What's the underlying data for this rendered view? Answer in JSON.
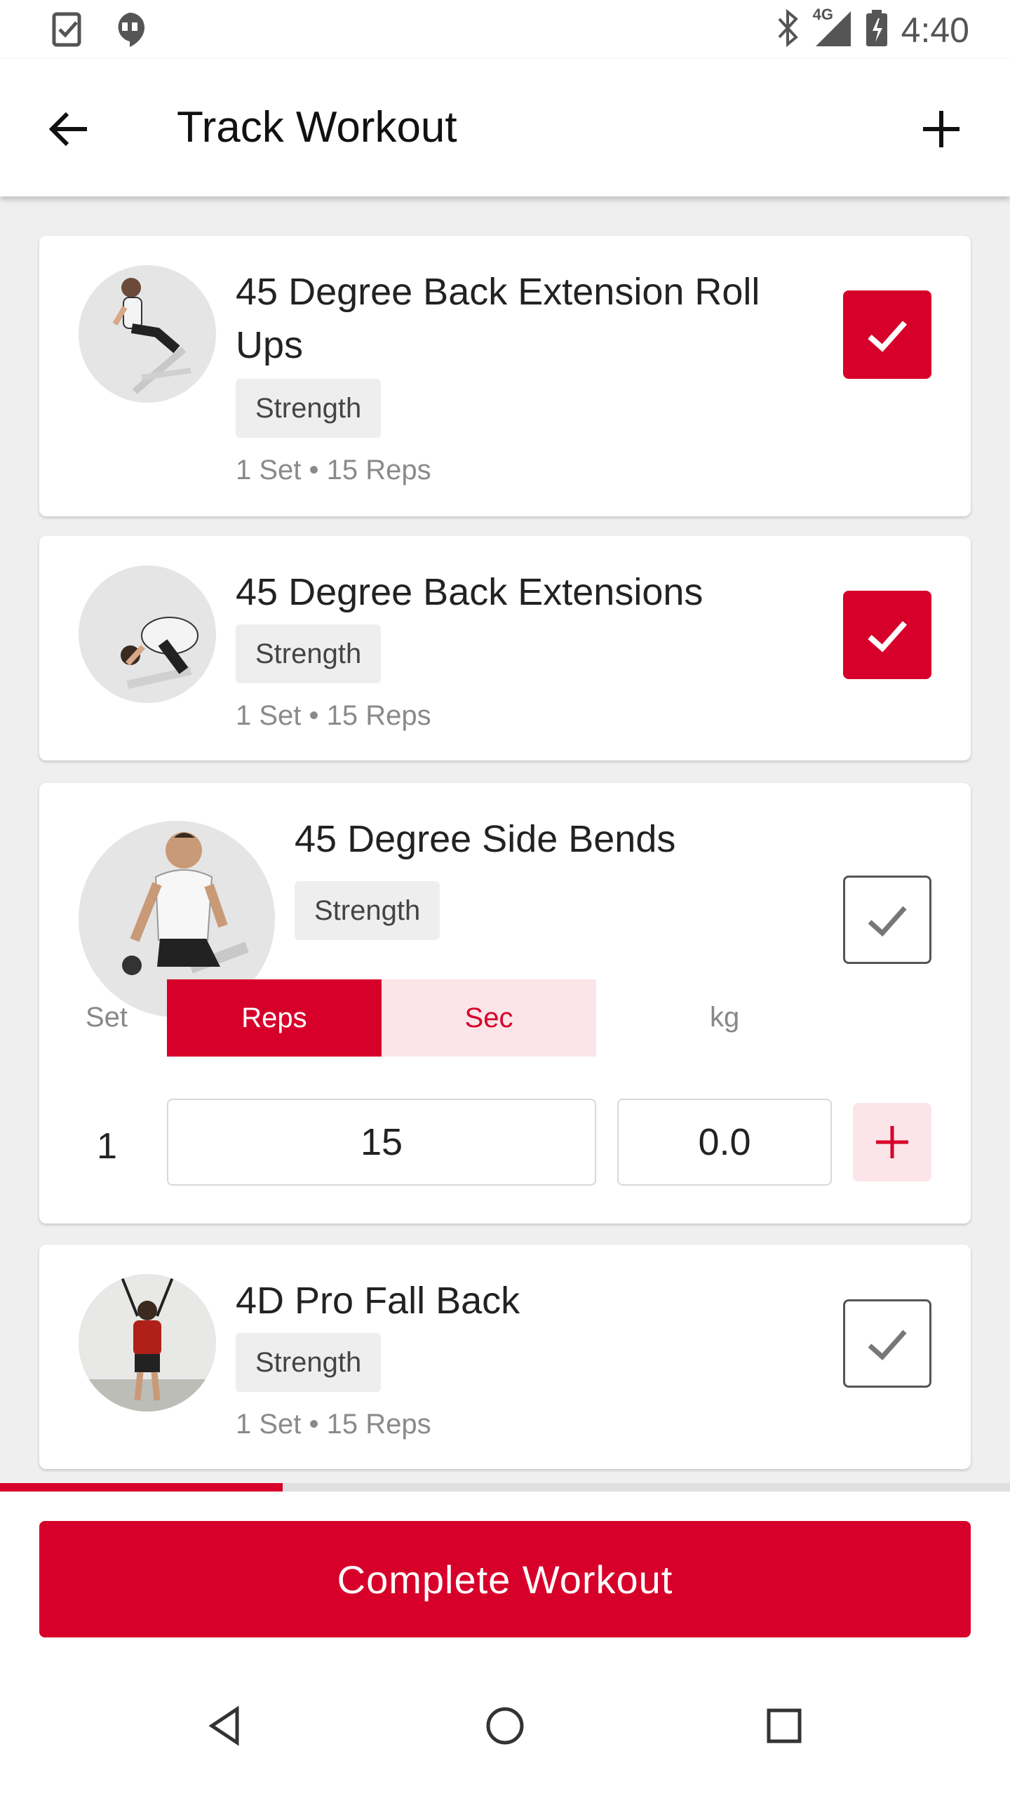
{
  "status_bar": {
    "time": "4:40",
    "network": "4G",
    "left_icons": [
      "task-icon",
      "hangouts-icon"
    ],
    "right_icons": [
      "bluetooth-icon",
      "signal-icon",
      "battery-charging-icon"
    ]
  },
  "app_bar": {
    "title": "Track Workout",
    "back_icon": "arrow-back-icon",
    "add_icon": "plus-icon"
  },
  "exercises": [
    {
      "title": "45 Degree Back Extension Roll Ups",
      "category": "Strength",
      "summary": "1 Set • 15 Reps",
      "completed": true
    },
    {
      "title": "45 Degree Back Extensions",
      "category": "Strength",
      "summary": "1 Set • 15 Reps",
      "completed": true
    },
    {
      "title": "45 Degree Side Bends",
      "category": "Strength",
      "completed": false,
      "expanded": true,
      "columns": {
        "set": "Set",
        "reps": "Reps",
        "sec": "Sec",
        "kg": "kg"
      },
      "mode": "Reps",
      "sets": [
        {
          "set": "1",
          "reps": "15",
          "kg": "0.0"
        }
      ]
    },
    {
      "title": "4D Pro Fall Back",
      "category": "Strength",
      "summary": "1 Set • 15 Reps",
      "completed": false
    }
  ],
  "progress": {
    "fraction": 0.28
  },
  "complete_button": "Complete Workout",
  "nav_bar": [
    "back-triangle-icon",
    "home-circle-icon",
    "recents-square-icon"
  ],
  "colors": {
    "accent": "#d7002a",
    "accent_light": "#fbe5e9",
    "background": "#efefef"
  }
}
